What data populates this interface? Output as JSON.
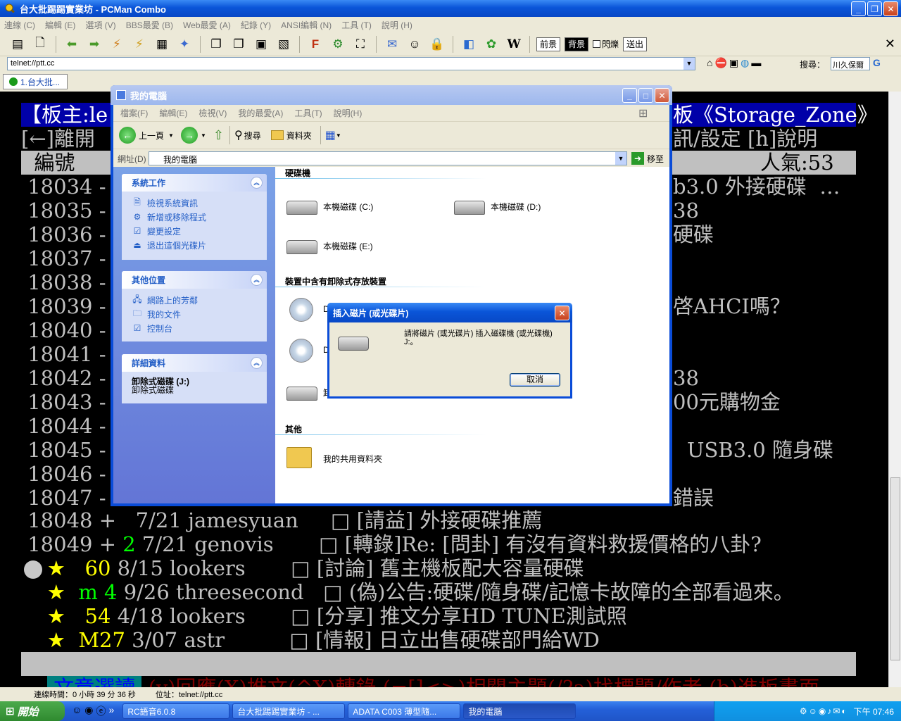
{
  "app": {
    "title": "台大批踢踢實業坊 - PCMan Combo",
    "menu": [
      "連線 (C)",
      "編輯 (E)",
      "選項 (V)",
      "BBS最愛 (B)",
      "Web最愛 (A)",
      "紀錄 (Y)",
      "ANSI編輯 (N)",
      "工具 (T)",
      "說明 (H)"
    ],
    "toolbar": {
      "front_label": "前景",
      "back_label": "背景",
      "flash_label": "閃爍",
      "send_label": "送出",
      "search_label": "搜尋：",
      "search_value": "川久保爾"
    },
    "address": "telnet://ptt.cc",
    "tab_label": "1.台大批..."
  },
  "terminal": {
    "lines": [
      {
        "text": "【板主:le",
        "style": "hl"
      },
      {
        "text": "[←]離開",
        "style": "normal"
      },
      {
        "text": "  編號",
        "style": "gray"
      },
      {
        "text": " 18034 -",
        "style": "normal"
      },
      {
        "text": " 18035 -",
        "style": "normal"
      },
      {
        "text": " 18036 -",
        "style": "normal"
      },
      {
        "text": " 18037 -",
        "style": "normal"
      },
      {
        "text": " 18038 -",
        "style": "normal"
      },
      {
        "text": " 18039 -",
        "style": "normal"
      },
      {
        "text": " 18040 -",
        "style": "normal"
      },
      {
        "text": " 18041 -",
        "style": "normal"
      },
      {
        "text": " 18042 -",
        "style": "normal"
      },
      {
        "text": " 18043 -",
        "style": "normal"
      },
      {
        "text": " 18044 -",
        "style": "normal"
      },
      {
        "text": " 18045 -",
        "style": "normal"
      },
      {
        "text": " 18046 -",
        "style": "normal"
      },
      {
        "text": " 18047 -",
        "style": "normal"
      }
    ],
    "right_fragments": [
      {
        "text": "板《Storage_Zone》",
        "style": "hl"
      },
      {
        "text": "訊/設定 [h]說明",
        "style": "normal"
      },
      {
        "text": "人氣:53 ",
        "style": "gray"
      },
      {
        "text": "b3.0 外接硬碟  …",
        "style": "normal"
      },
      {
        "text": "38",
        "style": "normal"
      },
      {
        "text": "硬碟",
        "style": "normal"
      },
      {
        "text": "",
        "style": "normal"
      },
      {
        "text": "",
        "style": "normal"
      },
      {
        "text": "啓AHCI嗎？",
        "style": "normal"
      },
      {
        "text": "",
        "style": "normal"
      },
      {
        "text": "",
        "style": "normal"
      },
      {
        "text": "38",
        "style": "normal"
      },
      {
        "text": "00元購物金",
        "style": "normal"
      },
      {
        "text": "",
        "style": "normal"
      },
      {
        "text": "USB3.0 隨身碟",
        "style": "normal"
      },
      {
        "text": "",
        "style": "normal"
      },
      {
        "text": "錯誤",
        "style": "normal"
      }
    ],
    "bottom_lines": [
      {
        "num": " 18048 +",
        "push": "  ",
        "date": " 7/21",
        "author": " jamesyuan    ",
        "title": " □ [請益] 外接硬碟推薦"
      },
      {
        "num": " 18049 +",
        "push": " 2",
        "date": " 7/21",
        "author": " genovis      ",
        "title": " □ [轉錄]Re: [問卦] 有沒有資料救援價格的八卦?"
      },
      {
        "num": "    ★  ",
        "push": " 60",
        "date": " 8/15",
        "author": " lookers      ",
        "title": " □ [討論] 舊主機板配大容量硬碟"
      },
      {
        "num": "    ★  ",
        "push": "m 4",
        "date": " 9/26",
        "author": " threesecond  ",
        "title": " □ (偽)公告:硬碟/隨身碟/記憶卡故障的全部看過來。"
      },
      {
        "num": "    ★  ",
        "push": " 54",
        "date": " 4/18",
        "author": " lookers      ",
        "title": " □ [分享] 推文分享HD TUNE測試照"
      },
      {
        "num": "    ★  ",
        "push": "M27",
        "date": " 3/07",
        "author": " astr         ",
        "title": " □ [情報] 日立出售硬碟部門給WD"
      }
    ],
    "footer_label": " 文章選讀 ",
    "footer_text": " (y)回應(X)推文(^X)轉錄 (=[]<>)相關主題(/?a)找標題/作者 (b)進板畫面 "
  },
  "status": {
    "connect_time": "連線時間：0 小時 39 分 36 秒",
    "location": "位址：telnet://ptt.cc"
  },
  "explorer": {
    "title": "我的電腦",
    "menu": [
      "檔案(F)",
      "編輯(E)",
      "檢視(V)",
      "我的最愛(A)",
      "工具(T)",
      "說明(H)"
    ],
    "back_label": "上一頁",
    "search_label": "搜尋",
    "folders_label": "資料夾",
    "address_label": "網址(D)",
    "address_value": "我的電腦",
    "go_label": "移至",
    "panels": {
      "tasks": {
        "title": "系統工作",
        "items": [
          "檢視系統資訊",
          "新增或移除程式",
          "變更設定",
          "退出這個光碟片"
        ]
      },
      "places": {
        "title": "其他位置",
        "items": [
          "網路上的芳鄰",
          "我的文件",
          "控制台"
        ]
      },
      "details": {
        "title": "詳細資料",
        "name": "卸除式磁碟 (J:)",
        "type": "卸除式磁碟"
      }
    },
    "sections": {
      "hdd": "硬碟機",
      "removable": "裝置中含有卸除式存放裝置",
      "other": "其他"
    },
    "drives": [
      "本機磁碟 (C:)",
      "本機磁碟 (D:)",
      "本機磁碟 (E:)"
    ],
    "removable_labels": [
      "D",
      "D",
      "卸"
    ],
    "shared_folder": "我的共用資料夾"
  },
  "dialog": {
    "title": "插入磁片 (或光碟片)",
    "message": "請將磁片 (或光碟片) 插入磁碟機 (或光碟機) J:。",
    "cancel_label": "取消"
  },
  "taskbar": {
    "start_label": "開始",
    "tasks": [
      "RC語音6.0.8",
      "台大批踢踢實業坊 - ...",
      "ADATA C003 薄型隨...",
      "我的電腦"
    ],
    "clock": "下午 07:46"
  }
}
